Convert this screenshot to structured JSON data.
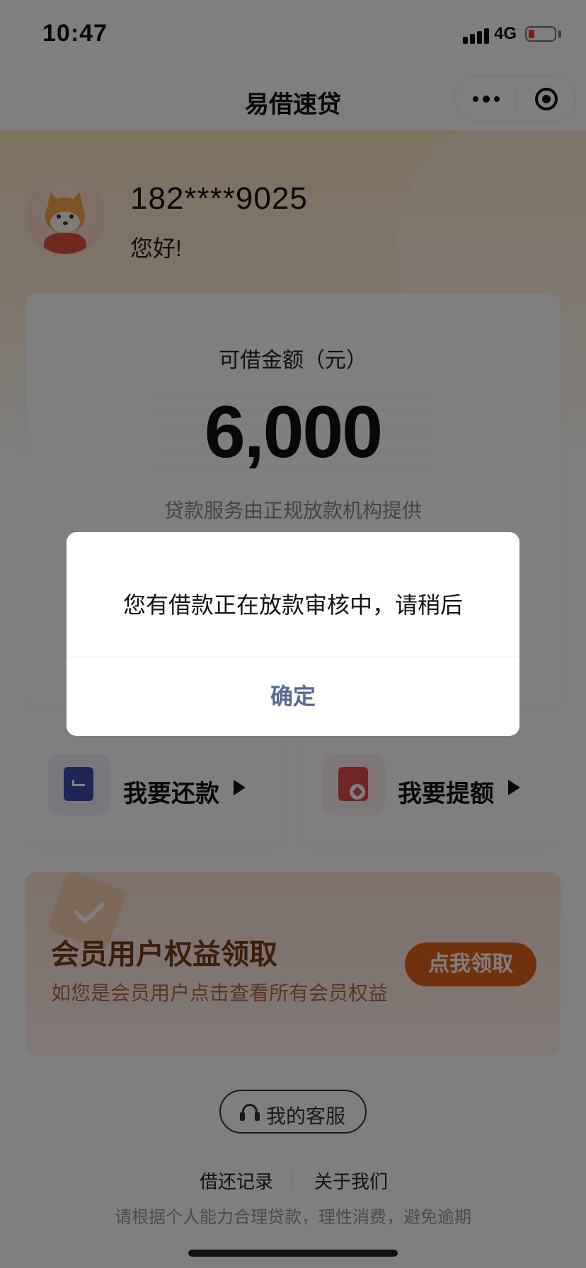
{
  "status_bar": {
    "time": "10:47",
    "network": "4G"
  },
  "nav": {
    "title": "易借速贷",
    "more_icon": "more-dots-icon",
    "close_icon": "target-icon"
  },
  "user": {
    "phone": "182****9025",
    "greeting": "您好!"
  },
  "amount_card": {
    "label": "可借金额（元）",
    "amount": "6,000",
    "note": "贷款服务由正规放款机构提供"
  },
  "actions": [
    {
      "label": "我要还款",
      "icon": "repay-icon",
      "color": "#3e4aa8",
      "bg": "#eef0fb"
    },
    {
      "label": "我要提额",
      "icon": "raise-limit-icon",
      "color": "#e04c4c",
      "bg": "#fdeeee"
    }
  ],
  "member": {
    "title": "会员用户权益领取",
    "subtitle": "如您是会员用户点击查看所有会员权益",
    "button": "点我领取"
  },
  "service": {
    "label": "我的客服"
  },
  "links": {
    "records": "借还记录",
    "about": "关于我们"
  },
  "disclaimer": "请根据个人能力合理贷款，理性消费，避免逾期",
  "modal": {
    "message": "您有借款正在放款审核中，请稍后",
    "confirm": "确定"
  },
  "colors": {
    "accent_orange": "#e5631b",
    "link_blue": "#576b95"
  }
}
